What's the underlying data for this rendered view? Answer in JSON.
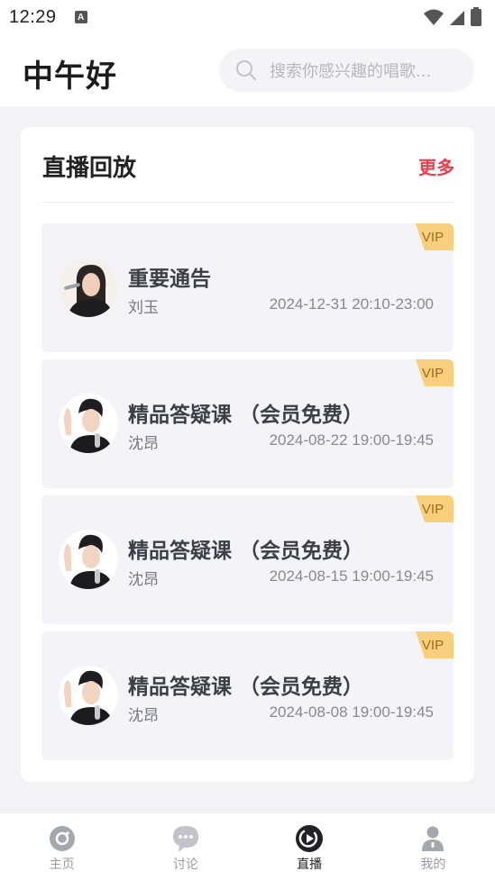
{
  "status_bar": {
    "time": "12:29",
    "notification_icon_letter": "A",
    "icons": [
      "wifi-icon",
      "signal-icon",
      "battery-icon"
    ]
  },
  "header": {
    "greeting": "中午好",
    "search_placeholder": "搜索你感兴趣的唱歌..."
  },
  "section": {
    "title": "直播回放",
    "more_label": "更多"
  },
  "replays": [
    {
      "title": "重要通告",
      "host": "刘玉",
      "time": "2024-12-31 20:10-23:00",
      "badge": "VIP"
    },
    {
      "title": "精品答疑课 （会员免费）",
      "host": "沈昂",
      "time": "2024-08-22 19:00-19:45",
      "badge": "VIP"
    },
    {
      "title": "精品答疑课 （会员免费）",
      "host": "沈昂",
      "time": "2024-08-15 19:00-19:45",
      "badge": "VIP"
    },
    {
      "title": "精品答疑课 （会员免费）",
      "host": "沈昂",
      "time": "2024-08-08 19:00-19:45",
      "badge": "VIP"
    }
  ],
  "bottom_nav": [
    {
      "label": "主页",
      "icon": "home-camera-icon",
      "active": false
    },
    {
      "label": "讨论",
      "icon": "chat-bubble-icon",
      "active": false
    },
    {
      "label": "直播",
      "icon": "live-play-icon",
      "active": true
    },
    {
      "label": "我的",
      "icon": "profile-icon",
      "active": false
    }
  ],
  "colors": {
    "accent_red": "#ee3d4c",
    "vip_gold": "#f7cf7d",
    "vip_text": "#a16b1b",
    "background": "#f3f3f6",
    "item_bg": "#f4f4f8"
  }
}
